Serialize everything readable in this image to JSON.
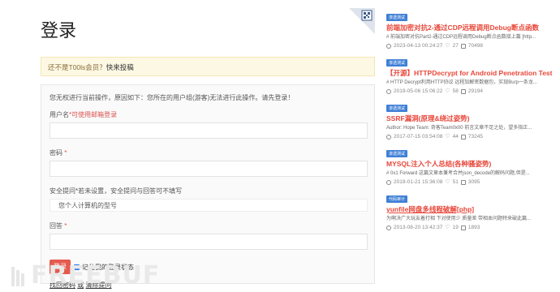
{
  "login": {
    "title": "登录",
    "notice_prefix": "还不是T00ls会员？",
    "notice_link": "快来投稿",
    "message": "您无权进行当前操作，原因如下：您所在的用户组(游客)无法进行此操作。请先登录！",
    "username_label": "用户名",
    "username_note": "*可使用邮箱登录",
    "password_label": "密码",
    "required_mark": "*",
    "security_label": "安全提问",
    "security_note": "*若未设置，安全提问与回答可不填写",
    "security_selected": "您个人计算机的型号",
    "answer_label": "回答",
    "login_button": "登录",
    "remember_label": "记住我的登录状态",
    "link_forgot": "找回密码",
    "link_or": "或",
    "link_clear": "清除提问"
  },
  "watermark": "FREEBUF",
  "sidebar": {
    "posts": [
      {
        "tag": "渗透测试",
        "title": "前端加密对抗2-通过CDP远程调用Debug断点函数",
        "underline": false,
        "excerpt": "# 前端加密对抗Part2-通过CDP远程调用Debug断点函数接上篇 [http...",
        "date": "2023-04-13 00:24:27",
        "likes": "27",
        "views": "70498"
      },
      {
        "tag": "渗透测试",
        "title": "【开源】HTTPDecrypt for Android Penetration Test",
        "underline": false,
        "excerpt": "# HTTP Decrypt利用HTTP协议 远程加解密数据包，实现Burp一条龙...",
        "date": "2019-05-06 15:06:22",
        "likes": "58",
        "views": "29194"
      },
      {
        "tag": "渗透测试",
        "title": "SSRF漏洞(原理&绕过姿势)",
        "underline": false,
        "excerpt": "Author: Hope Team: 奇客Team0x00 前言文章不足之处，望多指正...",
        "date": "2017-07-15 03:54:08",
        "likes": "44",
        "views": "73245"
      },
      {
        "tag": "渗透测试",
        "title": "MYSQL注入个人总结(各种骚姿势)",
        "underline": false,
        "excerpt": "# 0x1 Forward 这篇文章本兼考合并json_decode的解码问题,但是...",
        "date": "2019-01-21 15:36:08",
        "likes": "51",
        "views": "3095"
      },
      {
        "tag": "代码审计",
        "title": "yunfile网盘多线程破解[php]",
        "underline": true,
        "excerpt": "为啊决广大玩友着打相 下对使用少 质量差 带相本问题特来破此篇...",
        "date": "2013-08-20 13:42:37",
        "likes": "19",
        "views": "1893"
      }
    ]
  },
  "colors": {
    "accent_red": "#e8473a",
    "tag_blue": "#3f7fd6",
    "button_red": "#e55a4e",
    "notice_bg": "#fcf8e3"
  }
}
